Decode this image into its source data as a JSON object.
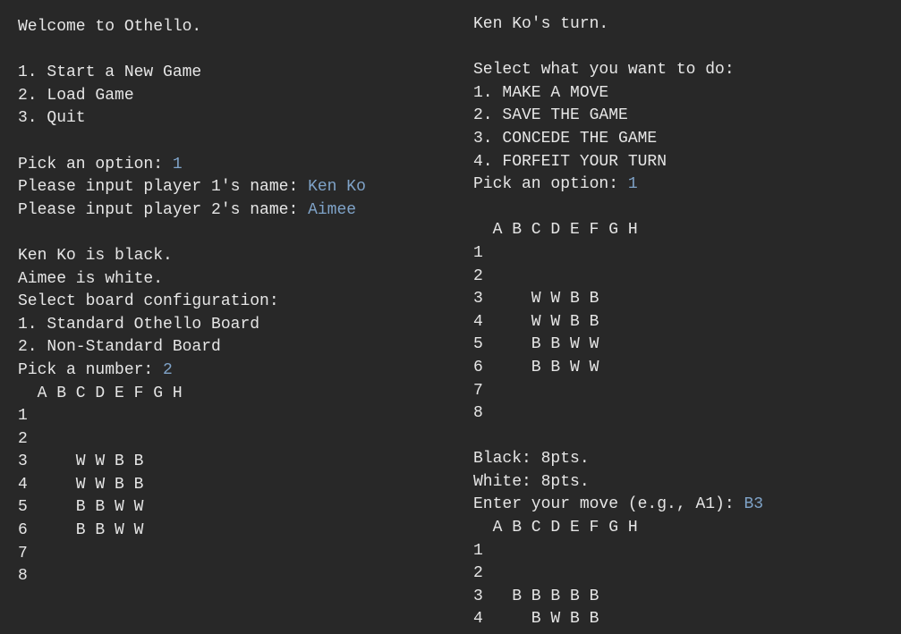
{
  "colors": {
    "background": "#282828",
    "text": "#e6e6e6",
    "input": "#7fa3c8"
  },
  "left": {
    "lines": [
      {
        "text": "Welcome to Othello.",
        "input": ""
      },
      {
        "text": "",
        "input": ""
      },
      {
        "text": "1. Start a New Game",
        "input": ""
      },
      {
        "text": "2. Load Game",
        "input": ""
      },
      {
        "text": "3. Quit",
        "input": ""
      },
      {
        "text": "",
        "input": ""
      },
      {
        "text": "Pick an option: ",
        "input": "1"
      },
      {
        "text": "Please input player 1's name: ",
        "input": "Ken Ko"
      },
      {
        "text": "Please input player 2's name: ",
        "input": "Aimee"
      },
      {
        "text": "",
        "input": ""
      },
      {
        "text": "Ken Ko is black.",
        "input": ""
      },
      {
        "text": "Aimee is white.",
        "input": ""
      },
      {
        "text": "Select board configuration:",
        "input": ""
      },
      {
        "text": "1. Standard Othello Board",
        "input": ""
      },
      {
        "text": "2. Non-Standard Board",
        "input": ""
      },
      {
        "text": "Pick a number: ",
        "input": "2"
      }
    ],
    "board": {
      "header": "  A B C D E F G H",
      "rows": [
        "1",
        "2",
        "3     W W B B",
        "4     W W B B",
        "5     B B W W",
        "6     B B W W",
        "7",
        "8"
      ]
    }
  },
  "right": {
    "lines": [
      {
        "text": "Ken Ko's turn.",
        "input": ""
      },
      {
        "text": "",
        "input": ""
      },
      {
        "text": "Select what you want to do:",
        "input": ""
      },
      {
        "text": "1. MAKE A MOVE",
        "input": ""
      },
      {
        "text": "2. SAVE THE GAME",
        "input": ""
      },
      {
        "text": "3. CONCEDE THE GAME",
        "input": ""
      },
      {
        "text": "4. FORFEIT YOUR TURN",
        "input": ""
      },
      {
        "text": "Pick an option: ",
        "input": "1"
      },
      {
        "text": "",
        "input": ""
      }
    ],
    "board1": {
      "header": "  A B C D E F G H",
      "rows": [
        "1",
        "2",
        "3     W W B B",
        "4     W W B B",
        "5     B B W W",
        "6     B B W W",
        "7",
        "8"
      ]
    },
    "after_lines": [
      {
        "text": "",
        "input": ""
      },
      {
        "text": "Black: 8pts.",
        "input": ""
      },
      {
        "text": "White: 8pts.",
        "input": ""
      },
      {
        "text": "Enter your move (e.g., A1): ",
        "input": "B3"
      }
    ],
    "board2": {
      "header": "  A B C D E F G H",
      "rows": [
        "1",
        "2",
        "3   B B B B B",
        "4     B W B B"
      ]
    }
  }
}
